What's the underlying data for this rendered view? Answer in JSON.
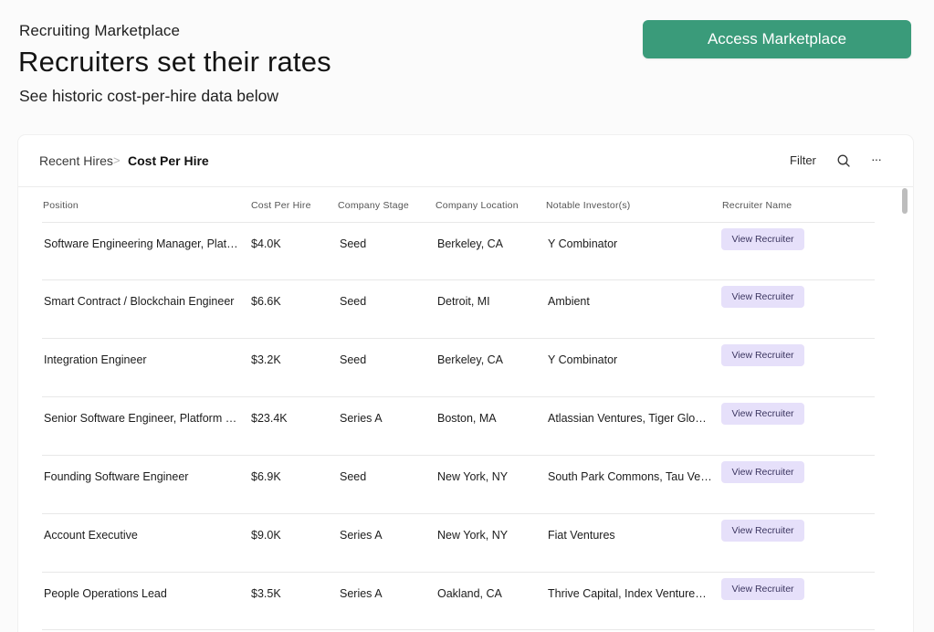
{
  "header": {
    "kicker": "Recruiting Marketplace",
    "title": "Recruiters set their rates",
    "subtitle": "See historic cost-per-hire data below",
    "cta_label": "Access Marketplace",
    "cta_color": "#3a9b7a"
  },
  "toolbar": {
    "breadcrumb": [
      "Recent Hires",
      "Cost Per Hire"
    ],
    "separator": ">",
    "filter_label": "Filter",
    "search_icon": "search-icon",
    "more_icon": "more-icon",
    "more_glyph": "···"
  },
  "table": {
    "columns": [
      "Position",
      "Cost Per Hire",
      "Company Stage",
      "Company Location",
      "Notable Investor(s)",
      "Recruiter Name"
    ],
    "button_label": "View Recruiter",
    "button_color": "#e6e0fa",
    "rows": [
      {
        "position": "Software Engineering Manager, Plat…",
        "cost": "$4.0K",
        "stage": "Seed",
        "location": "Berkeley, CA",
        "investors": "Y Combinator"
      },
      {
        "position": "Smart Contract / Blockchain Engineer",
        "cost": "$6.6K",
        "stage": "Seed",
        "location": "Detroit, MI",
        "investors": "Ambient"
      },
      {
        "position": "Integration Engineer",
        "cost": "$3.2K",
        "stage": "Seed",
        "location": "Berkeley, CA",
        "investors": "Y Combinator"
      },
      {
        "position": "Senior Software Engineer, Platform …",
        "cost": "$23.4K",
        "stage": "Series A",
        "location": "Boston, MA",
        "investors": "Atlassian Ventures, Tiger Glo…"
      },
      {
        "position": "Founding Software Engineer",
        "cost": "$6.9K",
        "stage": "Seed",
        "location": "New York, NY",
        "investors": "South Park Commons, Tau Ve…"
      },
      {
        "position": "Account Executive",
        "cost": "$9.0K",
        "stage": "Series A",
        "location": "New York, NY",
        "investors": "Fiat Ventures"
      },
      {
        "position": "People Operations Lead",
        "cost": "$3.5K",
        "stage": "Series A",
        "location": "Oakland, CA",
        "investors": "Thrive Capital, Index Venture…"
      }
    ]
  }
}
